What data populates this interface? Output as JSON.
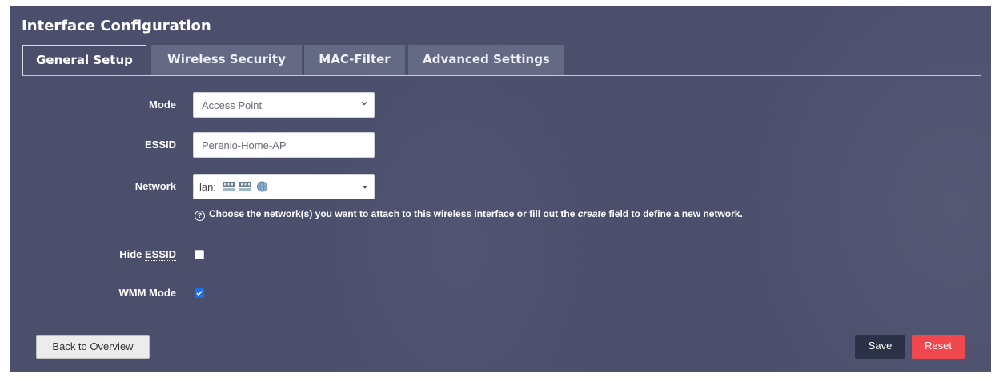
{
  "page": {
    "title": "Interface Configuration"
  },
  "tabs": [
    {
      "label": "General Setup",
      "active": true
    },
    {
      "label": "Wireless Security",
      "active": false
    },
    {
      "label": "MAC-Filter",
      "active": false
    },
    {
      "label": "Advanced Settings",
      "active": false
    }
  ],
  "form": {
    "mode": {
      "label": "Mode",
      "value": "Access Point"
    },
    "essid": {
      "label": "ESSID",
      "value": "Perenio-Home-AP"
    },
    "network": {
      "label": "Network",
      "value": "lan:",
      "icons": [
        "ethernet-port-icon",
        "ethernet-port-icon",
        "wireless-globe-icon"
      ],
      "help_before": "Choose the network(s) you want to attach to this wireless interface or fill out the ",
      "help_em": "create",
      "help_after": " field to define a new network."
    },
    "hide_essid": {
      "label_prefix": "Hide ",
      "label_abbr": "ESSID",
      "checked": false
    },
    "wmm_mode": {
      "label": "WMM Mode",
      "checked": true
    }
  },
  "actions": {
    "back_label": "Back to Overview",
    "save_label": "Save",
    "reset_label": "Reset"
  },
  "colors": {
    "panel_bg": "#4b4f6c",
    "inactive_tab_bg": "#656a84",
    "save_bg": "#2b3147",
    "reset_bg": "#f0484f",
    "checkbox_on": "#1d6fe8"
  }
}
